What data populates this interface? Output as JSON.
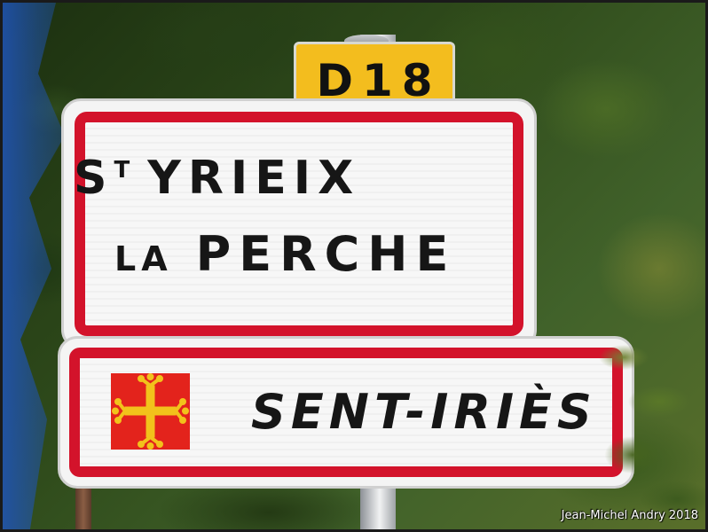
{
  "road_plate": {
    "number": "D18",
    "background_color": "#f3bd1e"
  },
  "town_sign": {
    "line1_st": "S",
    "line1_st_sup": "T",
    "line1_name": "YRIEIX",
    "line2_la": "LA",
    "line2_name": "PERCHE",
    "border_color": "#d3132b"
  },
  "occitan_sign": {
    "text": "SENT-IRIÈS",
    "emblem": "occitan-cross-icon",
    "emblem_bg_color": "#e3231c",
    "emblem_color": "#f2c21b"
  },
  "credit": "Jean-Michel Andry 2018"
}
